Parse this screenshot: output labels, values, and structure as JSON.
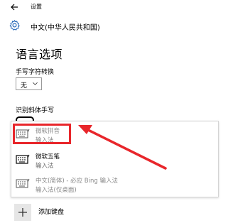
{
  "window": {
    "title": "设置"
  },
  "header": {
    "title": "中文(中华人民共和国)"
  },
  "section": {
    "title": "语言选项"
  },
  "handwriting_conversion": {
    "label": "手写字符转换",
    "selected": "无"
  },
  "italic_handwriting": {
    "label": "识别斜体手写"
  },
  "input_methods": [
    {
      "line1": "微软拼音",
      "line2": "输入法",
      "highlighted": true
    },
    {
      "line1": "微软五笔",
      "line2": "输入法",
      "highlighted": false
    },
    {
      "line1": "中文(简体) - 必应 Bing 输入法",
      "line2": "输入法(仅桌面)",
      "highlighted": false
    }
  ],
  "add_keyboard": {
    "label": "添加键盘"
  },
  "colors": {
    "highlight": "#e8262b",
    "arrow": "#e8262b"
  }
}
